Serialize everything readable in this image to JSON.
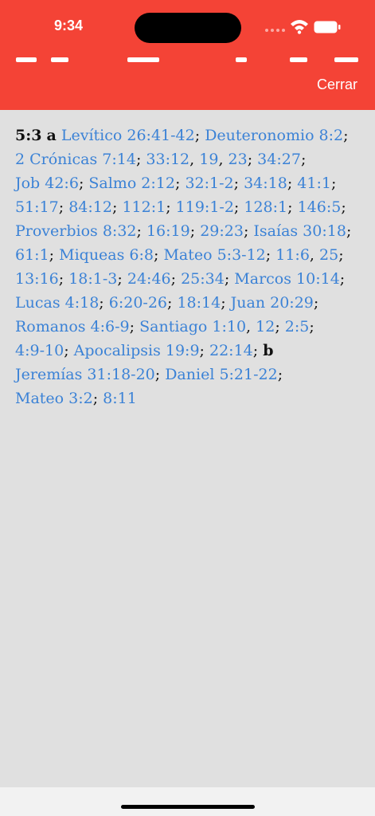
{
  "status_bar": {
    "time": "9:34"
  },
  "header": {
    "close_label": "Cerrar",
    "background": "#f44336"
  },
  "note": {
    "link_color": "#3b82d6",
    "lines": [
      [
        {
          "t": "mark",
          "v": "5:3"
        },
        {
          "t": "text",
          "v": " "
        },
        {
          "t": "mark",
          "v": "a"
        },
        {
          "t": "text",
          "v": " "
        },
        {
          "t": "ref",
          "v": "Levítico 26:41-42"
        },
        {
          "t": "text",
          "v": "; "
        },
        {
          "t": "ref",
          "v": "Deuteronomio 8:2"
        },
        {
          "t": "text",
          "v": ";"
        }
      ],
      [
        {
          "t": "ref",
          "v": "2 Crónicas 7:14"
        },
        {
          "t": "text",
          "v": "; "
        },
        {
          "t": "ref",
          "v": "33:12"
        },
        {
          "t": "text",
          "v": ", "
        },
        {
          "t": "ref",
          "v": "19"
        },
        {
          "t": "text",
          "v": ", "
        },
        {
          "t": "ref",
          "v": "23"
        },
        {
          "t": "text",
          "v": "; "
        },
        {
          "t": "ref",
          "v": "34:27"
        },
        {
          "t": "text",
          "v": ";"
        }
      ],
      [
        {
          "t": "ref",
          "v": "Job 42:6"
        },
        {
          "t": "text",
          "v": "; "
        },
        {
          "t": "ref",
          "v": "Salmo 2:12"
        },
        {
          "t": "text",
          "v": "; "
        },
        {
          "t": "ref",
          "v": "32:1-2"
        },
        {
          "t": "text",
          "v": "; "
        },
        {
          "t": "ref",
          "v": "34:18"
        },
        {
          "t": "text",
          "v": "; "
        },
        {
          "t": "ref",
          "v": "41:1"
        },
        {
          "t": "text",
          "v": ";"
        }
      ],
      [
        {
          "t": "ref",
          "v": "51:17"
        },
        {
          "t": "text",
          "v": "; "
        },
        {
          "t": "ref",
          "v": "84:12"
        },
        {
          "t": "text",
          "v": "; "
        },
        {
          "t": "ref",
          "v": "112:1"
        },
        {
          "t": "text",
          "v": "; "
        },
        {
          "t": "ref",
          "v": "119:1-2"
        },
        {
          "t": "text",
          "v": "; "
        },
        {
          "t": "ref",
          "v": "128:1"
        },
        {
          "t": "text",
          "v": "; "
        },
        {
          "t": "ref",
          "v": "146:5"
        },
        {
          "t": "text",
          "v": ";"
        }
      ],
      [
        {
          "t": "ref",
          "v": "Proverbios 8:32"
        },
        {
          "t": "text",
          "v": "; "
        },
        {
          "t": "ref",
          "v": "16:19"
        },
        {
          "t": "text",
          "v": "; "
        },
        {
          "t": "ref",
          "v": "29:23"
        },
        {
          "t": "text",
          "v": "; "
        },
        {
          "t": "ref",
          "v": "Isaías 30:18"
        },
        {
          "t": "text",
          "v": ";"
        }
      ],
      [
        {
          "t": "ref",
          "v": "61:1"
        },
        {
          "t": "text",
          "v": "; "
        },
        {
          "t": "ref",
          "v": "Miqueas 6:8"
        },
        {
          "t": "text",
          "v": "; "
        },
        {
          "t": "ref",
          "v": "Mateo 5:3-12"
        },
        {
          "t": "text",
          "v": "; "
        },
        {
          "t": "ref",
          "v": "11:6"
        },
        {
          "t": "text",
          "v": ", "
        },
        {
          "t": "ref",
          "v": "25"
        },
        {
          "t": "text",
          "v": ";"
        }
      ],
      [
        {
          "t": "ref",
          "v": "13:16"
        },
        {
          "t": "text",
          "v": "; "
        },
        {
          "t": "ref",
          "v": "18:1-3"
        },
        {
          "t": "text",
          "v": "; "
        },
        {
          "t": "ref",
          "v": "24:46"
        },
        {
          "t": "text",
          "v": "; "
        },
        {
          "t": "ref",
          "v": "25:34"
        },
        {
          "t": "text",
          "v": "; "
        },
        {
          "t": "ref",
          "v": "Marcos 10:14"
        },
        {
          "t": "text",
          "v": ";"
        }
      ],
      [
        {
          "t": "ref",
          "v": "Lucas 4:18"
        },
        {
          "t": "text",
          "v": "; "
        },
        {
          "t": "ref",
          "v": "6:20-26"
        },
        {
          "t": "text",
          "v": "; "
        },
        {
          "t": "ref",
          "v": "18:14"
        },
        {
          "t": "text",
          "v": "; "
        },
        {
          "t": "ref",
          "v": "Juan 20:29"
        },
        {
          "t": "text",
          "v": ";"
        }
      ],
      [
        {
          "t": "ref",
          "v": "Romanos 4:6-9"
        },
        {
          "t": "text",
          "v": "; "
        },
        {
          "t": "ref",
          "v": "Santiago 1:10"
        },
        {
          "t": "text",
          "v": ", "
        },
        {
          "t": "ref",
          "v": "12"
        },
        {
          "t": "text",
          "v": "; "
        },
        {
          "t": "ref",
          "v": "2:5"
        },
        {
          "t": "text",
          "v": ";"
        }
      ],
      [
        {
          "t": "ref",
          "v": "4:9-10"
        },
        {
          "t": "text",
          "v": "; "
        },
        {
          "t": "ref",
          "v": "Apocalipsis 19:9"
        },
        {
          "t": "text",
          "v": "; "
        },
        {
          "t": "ref",
          "v": "22:14"
        },
        {
          "t": "text",
          "v": "; "
        },
        {
          "t": "mark",
          "v": "b"
        }
      ],
      [
        {
          "t": "ref",
          "v": "Jeremías 31:18-20"
        },
        {
          "t": "text",
          "v": "; "
        },
        {
          "t": "ref",
          "v": "Daniel 5:21-22"
        },
        {
          "t": "text",
          "v": ";"
        }
      ],
      [
        {
          "t": "ref",
          "v": "Mateo 3:2"
        },
        {
          "t": "text",
          "v": "; "
        },
        {
          "t": "ref",
          "v": "8:11"
        }
      ]
    ]
  }
}
